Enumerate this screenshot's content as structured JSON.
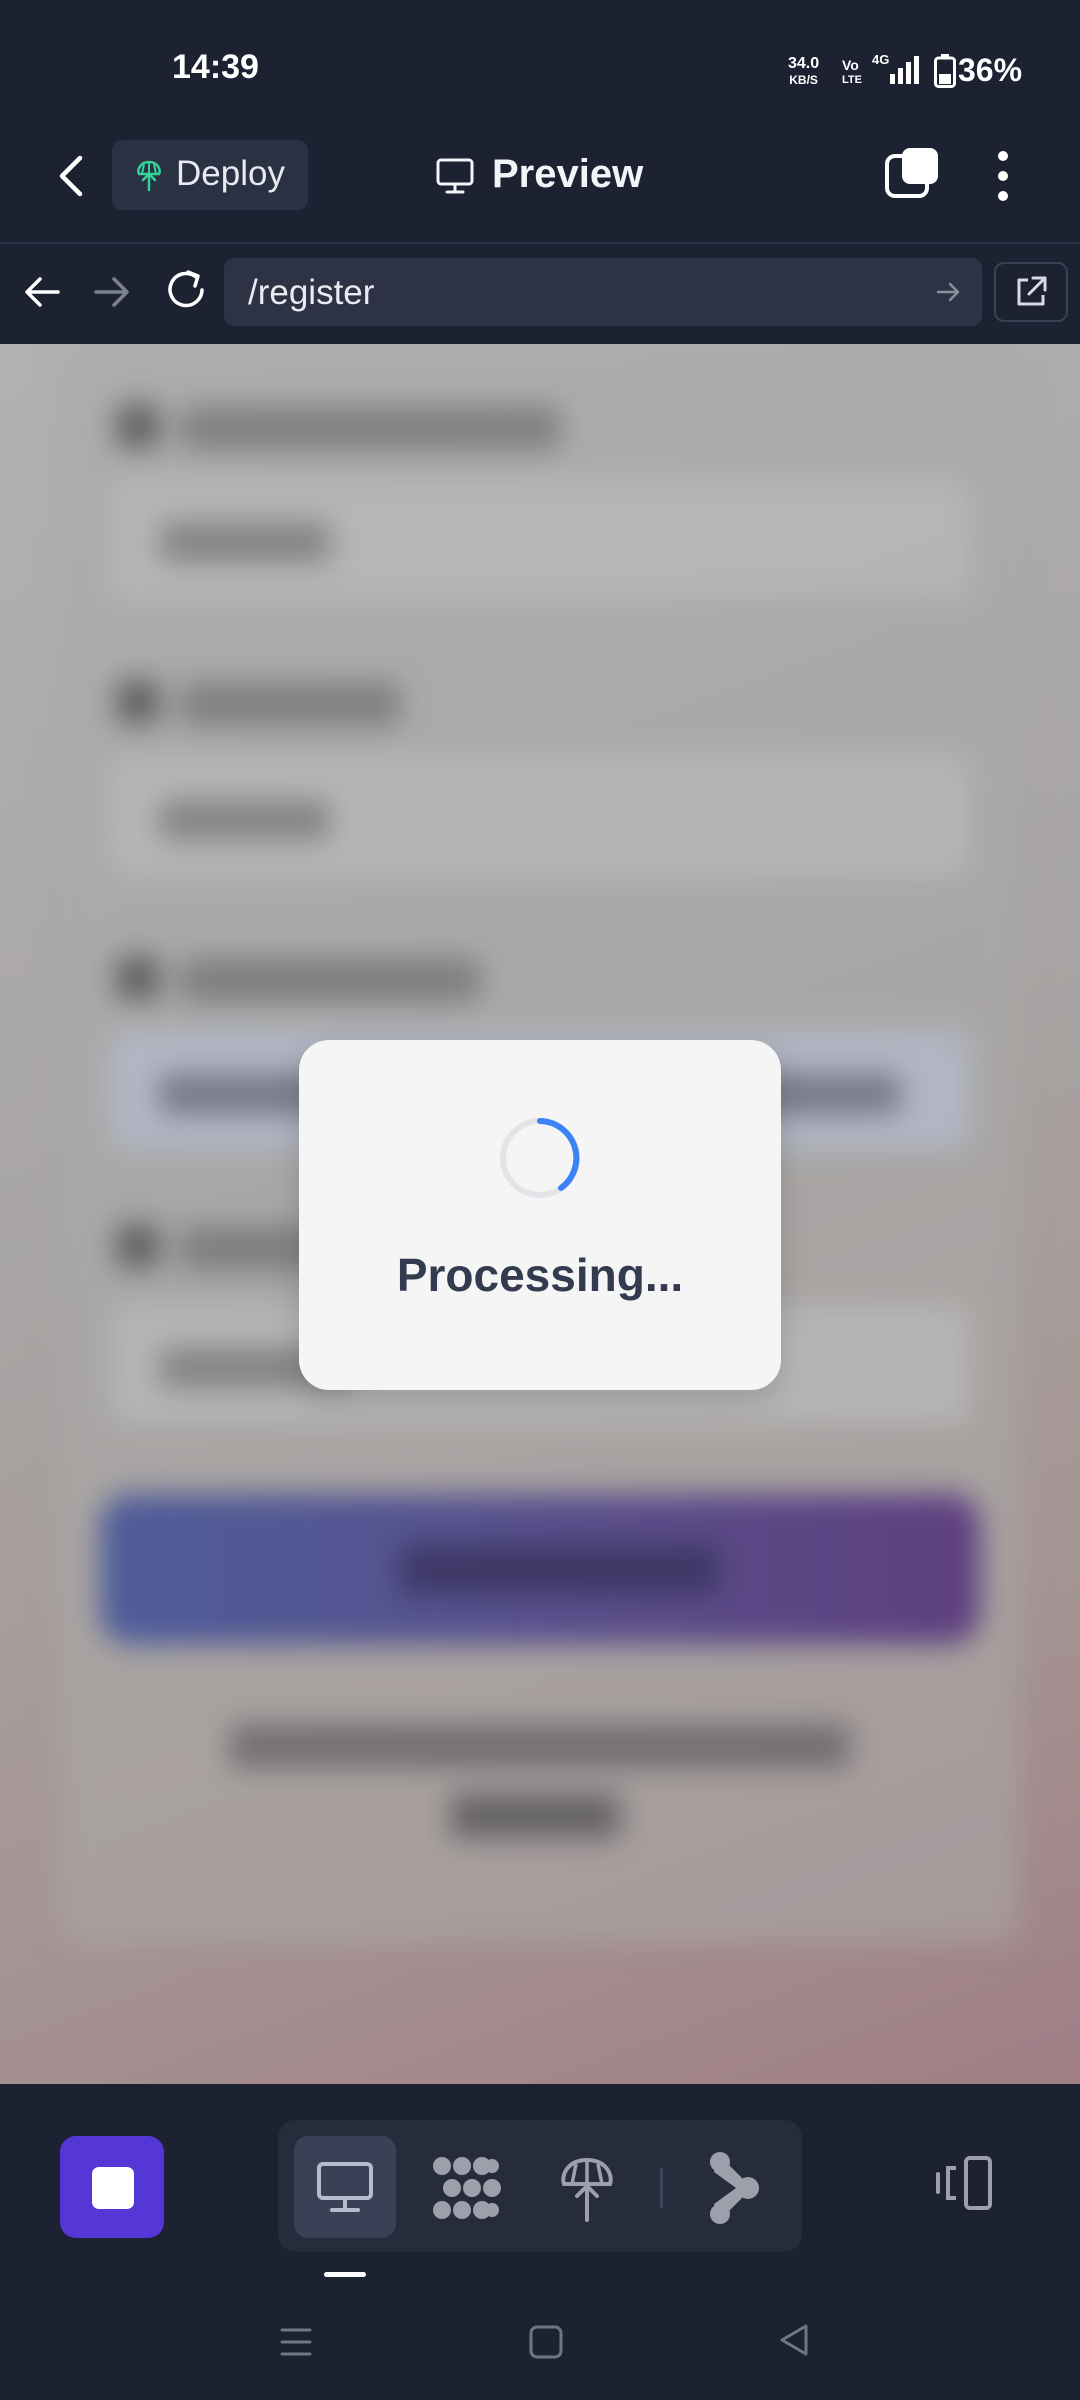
{
  "status_bar": {
    "time": "14:39",
    "net_speed_value": "34.0",
    "net_speed_unit": "KB/S",
    "volte_top": "Vo",
    "volte_bottom": "LTE",
    "network_type": "4G",
    "battery_pct": "36%"
  },
  "header": {
    "deploy_label": "Deploy",
    "title": "Preview"
  },
  "url_bar": {
    "path": "/register"
  },
  "modal": {
    "text": "Processing..."
  },
  "icons": {
    "back": "chevron-left-icon",
    "deploy": "deploy-tree-icon",
    "preview": "monitor-icon",
    "tabs": "tabs-icon",
    "more": "more-vertical-icon",
    "nav_back": "arrow-left-icon",
    "nav_forward": "arrow-right-icon",
    "reload": "reload-icon",
    "go": "arrow-right-icon",
    "open_external": "external-link-icon",
    "stop": "stop-icon",
    "desktop": "monitor-icon",
    "swarm": "swarm-icon",
    "deploy_seg": "deploy-icon",
    "branch": "branch-icon",
    "responsive": "responsive-icon"
  },
  "colors": {
    "app_bg": "#1d2232",
    "stop_button": "#5537d6",
    "spinner": "#3b82f6",
    "deploy_icon": "#34d399"
  }
}
